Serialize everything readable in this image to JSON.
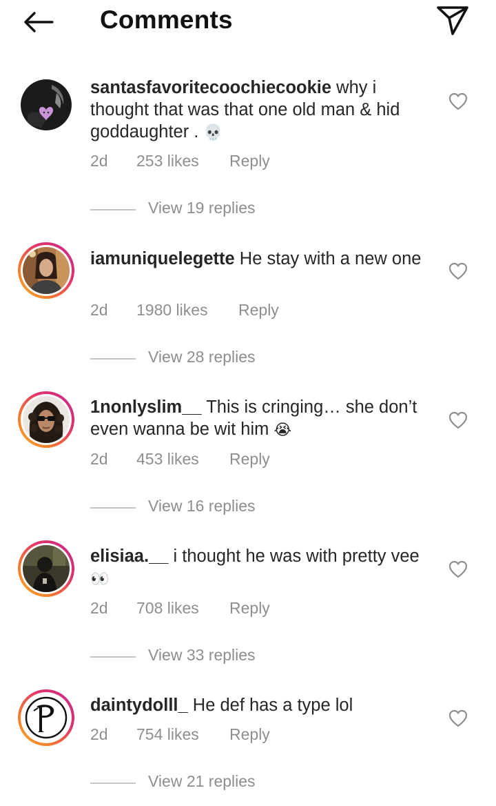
{
  "header": {
    "title": "Comments",
    "back_icon": "arrow-left-icon",
    "send_icon": "paper-plane-icon"
  },
  "colors": {
    "text": "#262626",
    "muted": "#8e8e8e",
    "divider": "#c7c7c7"
  },
  "comments": [
    {
      "username": "santasfavoritecoochiecookie",
      "text": "why i thought that was that one old man & hid goddaughter .",
      "emoji": "💀",
      "time": "2d",
      "likes": "253 likes",
      "reply": "Reply",
      "view_replies": "View 19 replies",
      "has_story": false
    },
    {
      "username": "iamuniquelegette",
      "text": "He stay with a new one",
      "emoji": "",
      "time": "2d",
      "likes": "1980 likes",
      "reply": "Reply",
      "view_replies": "View 28 replies",
      "has_story": true
    },
    {
      "username": "1nonlyslim__",
      "text": "This is cringing… she don’t even wanna be wit him",
      "emoji": "😭",
      "time": "2d",
      "likes": "453 likes",
      "reply": "Reply",
      "view_replies": "View 16 replies",
      "has_story": true
    },
    {
      "username": "elisiaa.__",
      "text": "i thought he was with pretty vee",
      "emoji": "👀",
      "time": "2d",
      "likes": "708 likes",
      "reply": "Reply",
      "view_replies": "View 33 replies",
      "has_story": true
    },
    {
      "username": "daintydolll_",
      "text": "He def has a type lol",
      "emoji": "",
      "time": "2d",
      "likes": "754 likes",
      "reply": "Reply",
      "view_replies": "View 21 replies",
      "has_story": true
    }
  ]
}
